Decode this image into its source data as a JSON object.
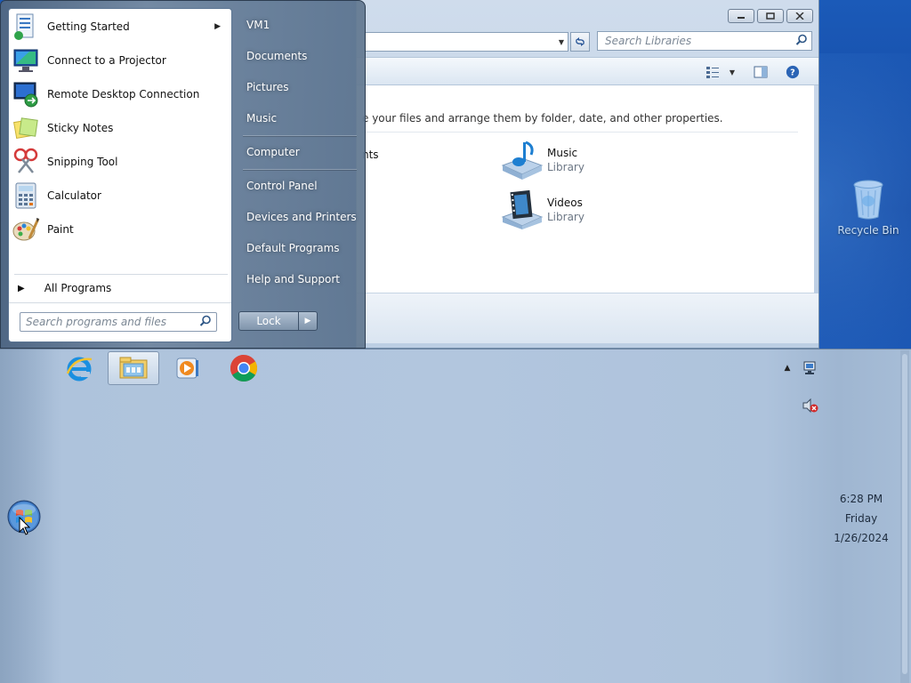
{
  "desktop": {
    "recycle_bin_label": "Recycle Bin"
  },
  "explorer": {
    "search_placeholder": "Search Libraries",
    "library_description": "e your files and arrange them by folder, date, and other properties.",
    "partial_item_label": "nts",
    "libraries": [
      {
        "name": "Music",
        "type": "Library",
        "icon": "music-library-icon"
      },
      {
        "name": "Videos",
        "type": "Library",
        "icon": "videos-library-icon"
      }
    ],
    "window_buttons": [
      "minimize",
      "maximize",
      "close"
    ]
  },
  "start_menu": {
    "programs": [
      {
        "label": "Getting Started",
        "icon": "getting-started-icon",
        "has_submenu": true
      },
      {
        "label": "Connect to a Projector",
        "icon": "projector-icon",
        "has_submenu": false
      },
      {
        "label": "Remote Desktop Connection",
        "icon": "remote-desktop-icon",
        "has_submenu": false
      },
      {
        "label": "Sticky Notes",
        "icon": "sticky-notes-icon",
        "has_submenu": false
      },
      {
        "label": "Snipping Tool",
        "icon": "snipping-tool-icon",
        "has_submenu": false
      },
      {
        "label": "Calculator",
        "icon": "calculator-icon",
        "has_submenu": false
      },
      {
        "label": "Paint",
        "icon": "paint-icon",
        "has_submenu": false
      }
    ],
    "all_programs": "All Programs",
    "search_placeholder": "Search programs and files",
    "right_items": [
      {
        "label": "VM1",
        "group": 0
      },
      {
        "label": "Documents",
        "group": 1
      },
      {
        "label": "Pictures",
        "group": 1
      },
      {
        "label": "Music",
        "group": 1
      },
      {
        "label": "Computer",
        "group": 2
      },
      {
        "label": "Control Panel",
        "group": 3
      },
      {
        "label": "Devices and Printers",
        "group": 3
      },
      {
        "label": "Default Programs",
        "group": 3
      },
      {
        "label": "Help and Support",
        "group": 3
      }
    ],
    "lock_label": "Lock"
  },
  "taskbar": {
    "pinned_apps": [
      {
        "name": "internet-explorer",
        "active": false
      },
      {
        "name": "windows-explorer",
        "active": true
      },
      {
        "name": "media-player",
        "active": false
      },
      {
        "name": "chrome",
        "active": false
      }
    ],
    "clock": {
      "time": "6:28 PM",
      "day": "Friday",
      "date": "1/26/2024"
    }
  },
  "colors": {
    "desktop_blue": "#1a4fa8",
    "taskbar": "#b2c6de",
    "start_menu_glass": "#788ca2"
  }
}
